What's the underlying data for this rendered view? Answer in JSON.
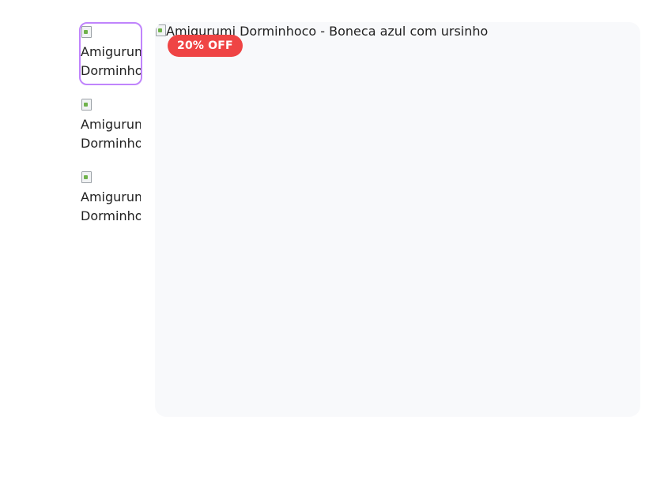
{
  "gallery": {
    "thumbnails": [
      {
        "alt": "Amigurumi Dorminhoco - Boneca azul com ursinho",
        "active": true
      },
      {
        "alt": "Amigurumi Dorminhoco - Boneca azul com ursinho",
        "active": false
      },
      {
        "alt": "Amigurumi Dorminhoco - Bebê",
        "active": false
      }
    ],
    "main_image": {
      "alt": "Amigurumi Dorminhoco - Boneca azul com ursinho"
    },
    "discount_badge": "20% OFF"
  },
  "colors": {
    "active_border": "#c084fc",
    "badge_bg": "#ef4444",
    "main_bg": "#f8f9fb"
  },
  "icons": [
    "broken-image-icon"
  ]
}
